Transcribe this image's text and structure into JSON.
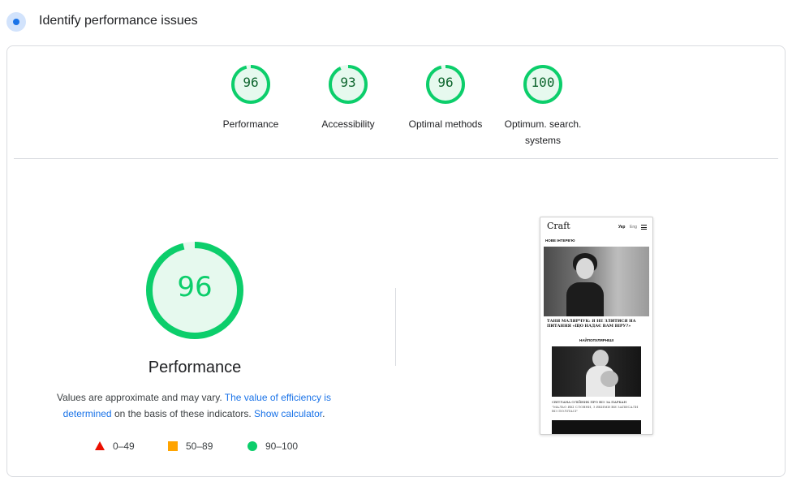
{
  "header": {
    "title": "Identify performance issues"
  },
  "categories": [
    {
      "score": "96",
      "label": "Performance",
      "value": 96
    },
    {
      "score": "93",
      "label": "Accessibility",
      "value": 93
    },
    {
      "score": "96",
      "label": "Optimal methods",
      "value": 96
    },
    {
      "score": "100",
      "label_line1": "Optimum. search.",
      "label_line2": "systems",
      "value": 100
    }
  ],
  "main_gauge": {
    "score": "96",
    "value": 96,
    "title": "Performance"
  },
  "description": {
    "text1": "Values are approximate and may vary. ",
    "link1": "The value of efficiency is determined",
    "text2": " on the basis of these indicators. ",
    "link2": "Show calculator",
    "text3": "."
  },
  "legend": {
    "fail": "0–49",
    "average": "50–89",
    "pass": "90–100"
  },
  "screenshot": {
    "logo": "Craft",
    "nav_active": "Укр",
    "nav_other": "Eng",
    "section1": "НОВЕ ІНТЕРВ'Ю",
    "caption1": "ТАНЯ МАЛЯРЧУК: Я НЕ ЗЛИТИСЯ НА ПИТАННЯ «ЩО НАДАЄ ВАМ ВІРУ?»",
    "section2": "НАЙПОПУЛЯРНІШІ",
    "caption2": "СВІТЛАНА ОЛІЙНИК ПРО ВІЗ ЗА ПАРКАН",
    "caption2_sub": "\"МАЛЬО ЯКІ СЛОВНИ, З ЯКИМИ ВИ ЗАПИСАЛИ ВІЗ ПОЛІТАСІ\""
  },
  "colors": {
    "pass": "#0cce6b",
    "pass_text": "#0d652d",
    "pass_bg": "#e6f9ee",
    "average": "#ffa400",
    "fail": "#eb0f00",
    "link": "#1a73e8"
  }
}
